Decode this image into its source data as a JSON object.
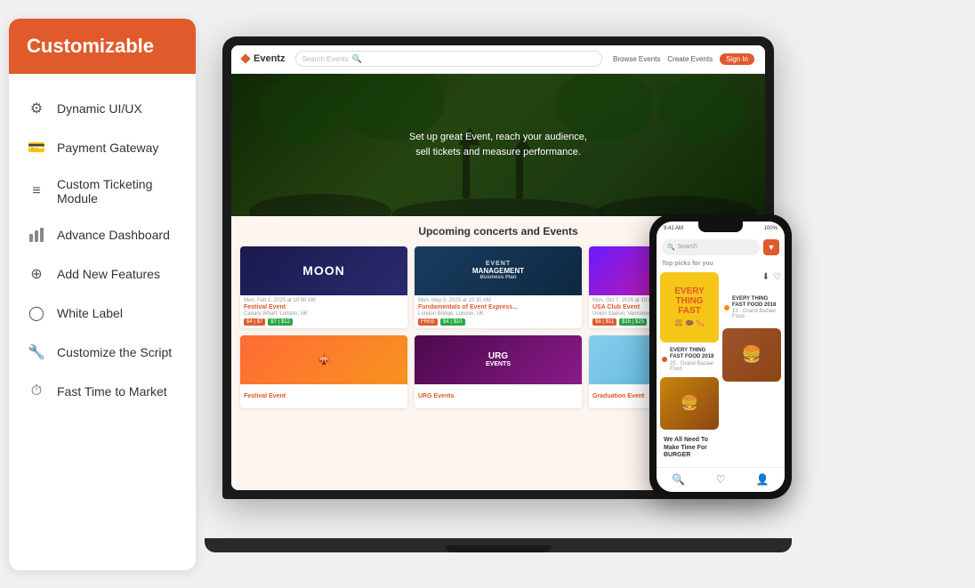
{
  "panel": {
    "header": "Customizable",
    "items": [
      {
        "id": "dynamic-ui",
        "label": "Dynamic UI/UX",
        "icon": "⚙"
      },
      {
        "id": "payment-gateway",
        "label": "Payment Gateway",
        "icon": "💳"
      },
      {
        "id": "custom-ticketing",
        "label": "Custom Ticketing Module",
        "icon": "≡"
      },
      {
        "id": "advance-dashboard",
        "label": "Advance Dashboard",
        "icon": "📊"
      },
      {
        "id": "add-features",
        "label": "Add New Features",
        "icon": "⊕"
      },
      {
        "id": "white-label",
        "label": "White Label",
        "icon": "◯"
      },
      {
        "id": "customize-script",
        "label": "Customize the Script",
        "icon": "🔧"
      },
      {
        "id": "fast-to-market",
        "label": "Fast Time to Market",
        "icon": "⏱"
      }
    ]
  },
  "website": {
    "logo": "Eventz",
    "search_placeholder": "Search Events",
    "nav_links": [
      "Browse Events",
      "Create Events"
    ],
    "sign_in": "Sign In",
    "hero_text_line1": "Set up great Event, reach your audience,",
    "hero_text_line2": "sell tickets and measure performance.",
    "events_section_title": "Upcoming concerts and Events",
    "events": [
      {
        "id": 1,
        "name": "Festival Event",
        "style": "moon",
        "text": "MOON",
        "date": "Mon, Feb 1, 2025 at 10:00 AM",
        "location": "Canary Wharf, London, UK",
        "price1": "$4 | $7",
        "price2": "$7 | $12"
      },
      {
        "id": 2,
        "name": "Fundamentals of Event Express...",
        "style": "mgmt",
        "text": "EVENT MANAGEMENT",
        "date": "Mon, May 5, 2025 at 10:30 AM",
        "location": "London Bridge, London, UK",
        "price1": "FREE",
        "price2": "$4 | $10"
      },
      {
        "id": 3,
        "name": "USA Club Event",
        "style": "club",
        "text": "",
        "date": "Mon, Oct 7, 2025 at 10:00 AM",
        "location": "Union Station, Vancouver.com, Licens...",
        "price1": "$8 | $11",
        "price2": "$15 | $25"
      },
      {
        "id": 4,
        "name": "Festival Event",
        "style": "festival1",
        "text": "",
        "date": "",
        "location": "",
        "price1": "",
        "price2": ""
      },
      {
        "id": 5,
        "name": "URG Events",
        "style": "urg",
        "text": "URG EVENTS",
        "date": "",
        "location": "",
        "price1": "",
        "price2": ""
      },
      {
        "id": 6,
        "name": "Graduation Event",
        "style": "grad",
        "text": "",
        "date": "",
        "location": "",
        "price1": "",
        "price2": ""
      }
    ]
  },
  "phone": {
    "time": "9:41 AM",
    "battery": "100%",
    "search_placeholder": "Search",
    "section_title": "Top picks for you",
    "card1_text": "EVERY THING FAST",
    "card1_sub": "EVERY THING FAST FOOD 2018",
    "card1_num": "25",
    "card1_venue": "Grand Bazaar Food",
    "burger_title": "We All Need To Make Time For BURGER",
    "card2_text": "EVERY THING FAST FOOD 2018",
    "card2_num": "13",
    "card2_venue": "Grand Bazaar Food",
    "bottom_nav": [
      "search",
      "heart",
      "person"
    ]
  },
  "colors": {
    "accent": "#e05a2b",
    "bg": "#f0f0f0",
    "card_bg": "#fff"
  }
}
